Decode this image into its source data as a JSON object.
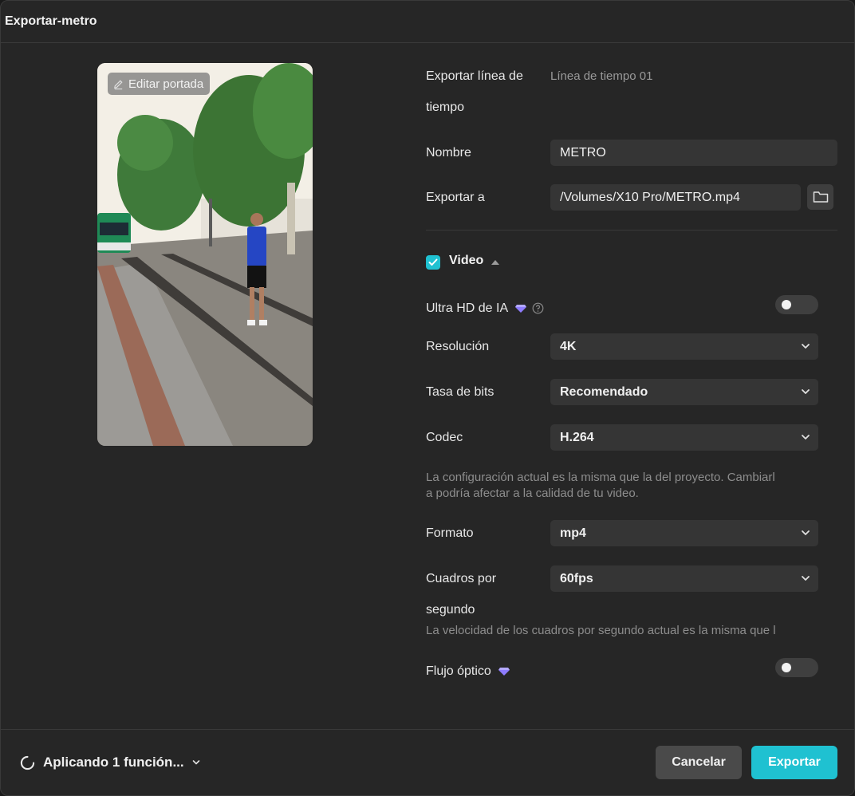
{
  "window": {
    "title": "Exportar-metro"
  },
  "preview": {
    "edit_cover_label": "Editar portada"
  },
  "form": {
    "timeline_label_1": "Exportar línea de",
    "timeline_label_2": "tiempo",
    "timeline_value": "Línea de tiempo 01",
    "name_label": "Nombre",
    "name_value": "METRO",
    "export_to_label": "Exportar a",
    "export_to_value": "/Volumes/X10 Pro/METRO.mp4"
  },
  "video": {
    "section_label": "Video",
    "checked": true,
    "ultra_hd_label": "Ultra HD de IA",
    "ultra_hd_on": false,
    "resolution_label": "Resolución",
    "resolution_value": "4K",
    "bitrate_label": "Tasa de bits",
    "bitrate_value": "Recomendado",
    "codec_label": "Codec",
    "codec_value": "H.264",
    "codec_note_1": "La configuración actual es la misma que la del proyecto. Cambiarl",
    "codec_note_2": "a podría afectar a la calidad de tu video.",
    "format_label": "Formato",
    "format_value": "mp4",
    "fps_label_1": "Cuadros por",
    "fps_label_2": "segundo",
    "fps_value": "60fps",
    "fps_note": "La velocidad de los cuadros por segundo actual es la misma que l",
    "optical_flow_label": "Flujo óptico",
    "optical_flow_on": false
  },
  "footer": {
    "status_text": "Aplicando 1 función...",
    "cancel_label": "Cancelar",
    "export_label": "Exportar"
  },
  "colors": {
    "accent": "#1fc1d1",
    "background": "#262626",
    "field": "#353535",
    "premium": "#8e7cff"
  }
}
